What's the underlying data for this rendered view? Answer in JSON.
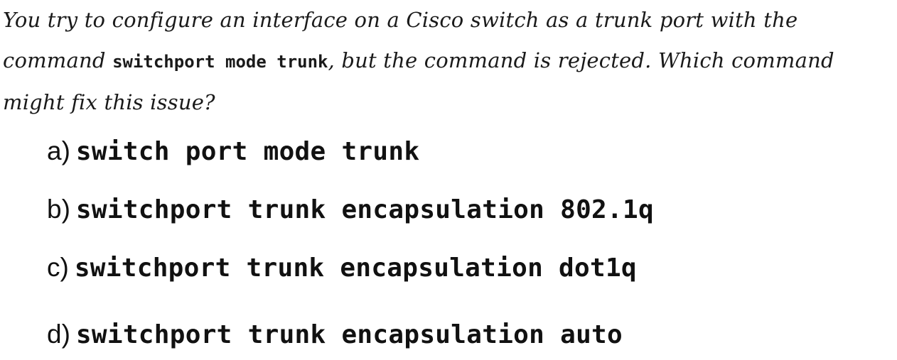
{
  "question": {
    "text_before": "You try to configure an interface on a Cisco switch as a trunk port with the command ",
    "command": "switchport mode trunk",
    "text_after": ", but the command is rejected.  Which command might fix this issue?"
  },
  "options": [
    {
      "letter": "a)",
      "command": "switch port mode trunk"
    },
    {
      "letter": "b)",
      "command": "switchport trunk encapsulation 802.1q"
    },
    {
      "letter": "c)",
      "command": "switchport trunk encapsulation dot1q"
    },
    {
      "letter": "d)",
      "command": "switchport trunk encapsulation auto"
    }
  ]
}
